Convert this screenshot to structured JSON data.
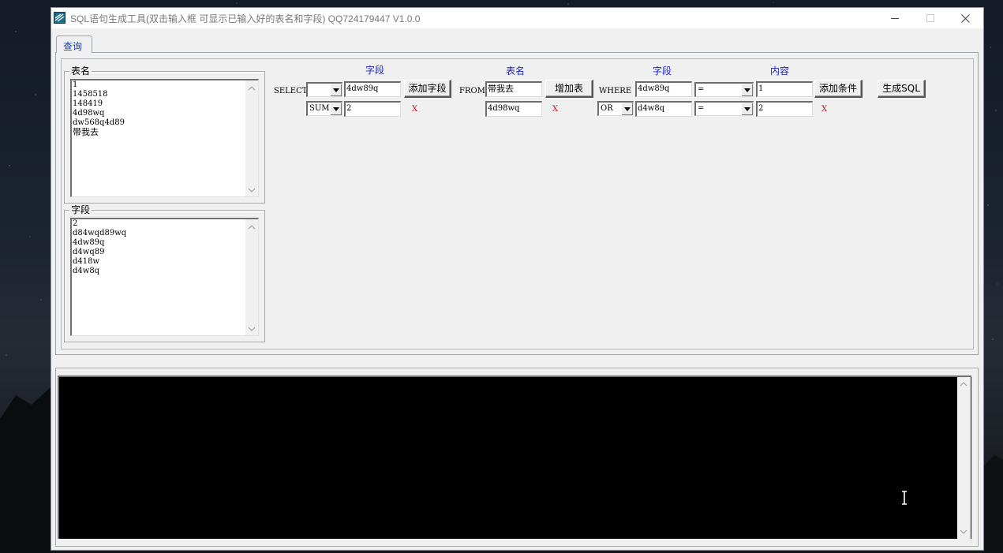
{
  "window": {
    "title": "SQL语句生成工具(双击输入框 可显示已输入好的表名和字段)   QQ724179447 V1.0.0",
    "app_icon": "sql-tool-icon",
    "controls": [
      "minimize-icon",
      "maximize-icon",
      "close-icon"
    ]
  },
  "tabs": [
    {
      "label": "查询",
      "active": true
    }
  ],
  "table_names_group": {
    "label": "表名",
    "items": [
      "1",
      "1458518",
      "148419",
      "4d98wq",
      "dw568q4d89",
      "带我去"
    ]
  },
  "fields_group": {
    "label": "字段",
    "items": [
      "2",
      "d84wqd89wq",
      "4dw89q",
      "d4wq89",
      "d418w",
      "d4w8q"
    ]
  },
  "select_section": {
    "header": "字段",
    "keyword": "SELECT",
    "rows": [
      {
        "aggregate": "",
        "field": "4dw89q",
        "remove_label": ""
      },
      {
        "aggregate": "SUM",
        "field": "2",
        "remove_label": "X"
      }
    ],
    "add_button": "添加字段"
  },
  "from_section": {
    "header": "表名",
    "keyword": "FROM",
    "rows": [
      {
        "table": "带我去",
        "remove_label": ""
      },
      {
        "table": "4d98wq",
        "remove_label": "X"
      }
    ],
    "add_button": "增加表"
  },
  "where_section": {
    "field_header": "字段",
    "value_header": "内容",
    "keyword": "WHERE",
    "rows": [
      {
        "connector": "",
        "field": "4dw89q",
        "operator": "=",
        "value": "1",
        "remove_label": ""
      },
      {
        "connector": "OR",
        "field": "d4w8q",
        "operator": "=",
        "value": "2",
        "remove_label": "X"
      }
    ],
    "add_button": "添加条件"
  },
  "generate_button": "生成SQL",
  "output": {
    "text": ""
  },
  "colors": {
    "header_blue": "#1c22c8",
    "remove_red": "#c1121f",
    "tab_blue": "#1c3fa8",
    "output_bg": "#000000"
  }
}
